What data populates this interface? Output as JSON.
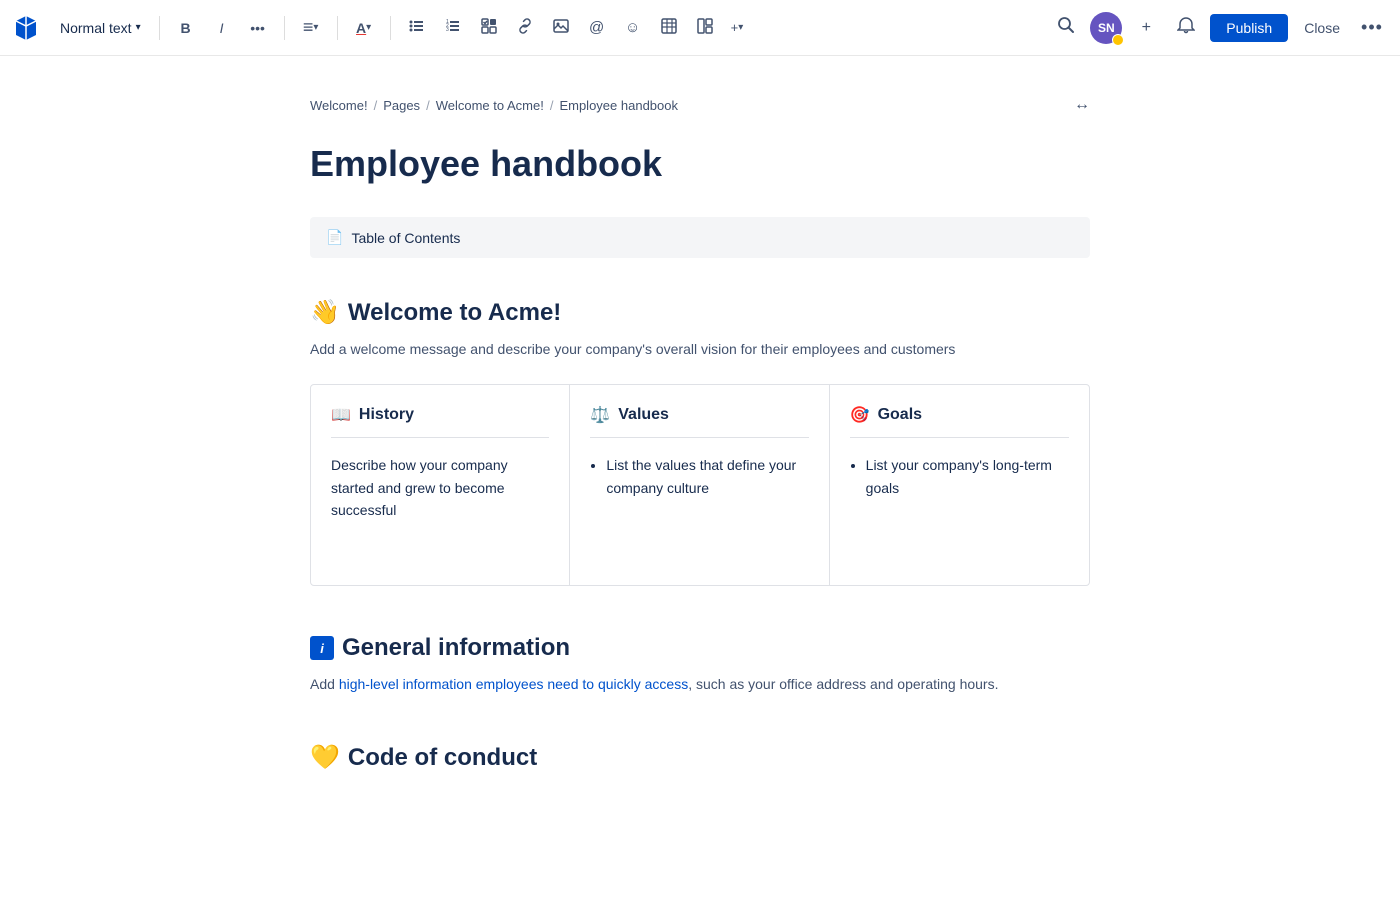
{
  "toolbar": {
    "text_style_label": "Normal text",
    "bold_label": "B",
    "italic_label": "I",
    "more_label": "•••",
    "align_label": "≡",
    "color_label": "A",
    "bullet_label": "☰",
    "numbered_label": "☰",
    "task_label": "☑",
    "link_label": "🔗",
    "image_label": "⬜",
    "mention_label": "@",
    "emoji_label": "☺",
    "table_label": "⊞",
    "layout_label": "⊟",
    "insert_label": "+▾",
    "search_label": "🔍",
    "avatar_initials": "SN",
    "invite_label": "+",
    "publish_label": "Publish",
    "close_label": "Close",
    "more_options_label": "•••"
  },
  "breadcrumb": {
    "items": [
      "Welcome!",
      "Pages",
      "Welcome to Acme!",
      "Employee handbook"
    ],
    "expand_icon": "↔"
  },
  "page": {
    "title": "Employee handbook",
    "toc_label": "Table of Contents",
    "toc_icon": "📄"
  },
  "welcome_section": {
    "emoji": "👋",
    "heading": "Welcome to Acme!",
    "subtitle": "Add a welcome message and describe your company's overall vision for their employees and customers",
    "cards": [
      {
        "emoji": "📖",
        "title": "History",
        "body_type": "text",
        "body": "Describe how your company started and grew to become successful"
      },
      {
        "emoji": "⚖️",
        "title": "Values",
        "body_type": "list",
        "items": [
          "List the values that define your company culture"
        ]
      },
      {
        "emoji": "🎯",
        "title": "Goals",
        "body_type": "list",
        "items": [
          "List your company's long-term goals"
        ]
      }
    ]
  },
  "general_section": {
    "emoji": "ℹ️",
    "heading": "General information",
    "subtitle_plain": "Add ",
    "subtitle_link": "high-level information employees need to quickly access",
    "subtitle_end": ", such as your office address and operating hours."
  },
  "code_section": {
    "emoji": "💛",
    "heading": "Code of conduct"
  }
}
